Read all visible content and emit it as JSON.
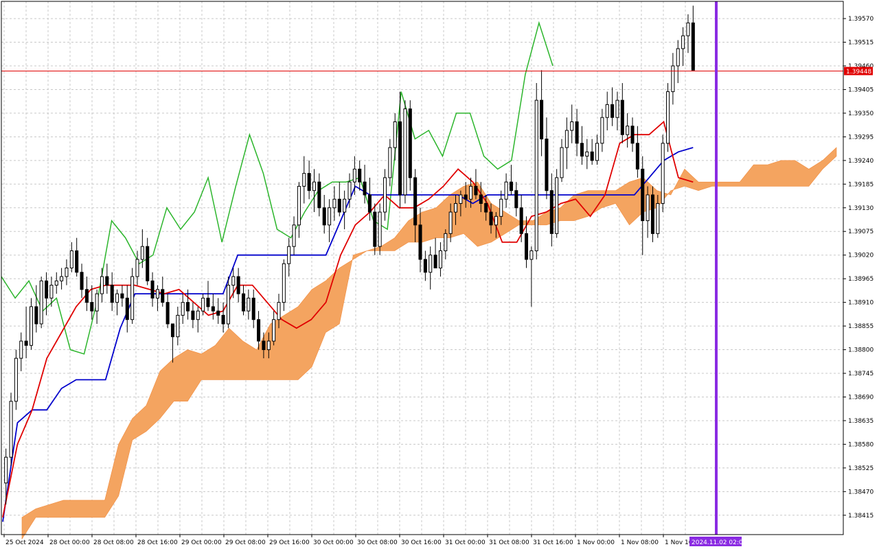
{
  "chart_data": {
    "type": "candlestick",
    "colors": {
      "background": "#ffffff",
      "grid": "#c8c8c8",
      "bull_candle": "#ffffff",
      "bear_candle": "#000000",
      "cloud": "#f4a460",
      "cloud_edge": "#f08a3c",
      "tenkan_sen": "#e00000",
      "kijun_sen": "#0000cc",
      "chikou_span": "#2bb52b",
      "price_line": "#e00000",
      "price_label_bg": "#e00000",
      "separator_line": "#8a2be2",
      "time_label_bg": "#8a2be2"
    },
    "y_ticks": [
      "1.39570",
      "1.39515",
      "1.39460",
      "1.39405",
      "1.39350",
      "1.39295",
      "1.39240",
      "1.39185",
      "1.39130",
      "1.39075",
      "1.39020",
      "1.38965",
      "1.38910",
      "1.38855",
      "1.38800",
      "1.38745",
      "1.38690",
      "1.38635",
      "1.38580",
      "1.38525",
      "1.38470",
      "1.38415"
    ],
    "x_ticks": [
      "25 Oct 2024",
      "28 Oct 00:00",
      "28 Oct 08:00",
      "28 Oct 16:00",
      "29 Oct 00:00",
      "29 Oct 08:00",
      "29 Oct 16:00",
      "30 Oct 00:00",
      "30 Oct 08:00",
      "30 Oct 16:00",
      "31 Oct 00:00",
      "31 Oct 08:00",
      "31 Oct 16:00",
      "1 Nov 00:00",
      "1 Nov 08:00",
      "1 Nov 16:"
    ],
    "ylim": [
      1.3837,
      1.3961
    ],
    "current_price": "1.39448",
    "separator_label": "2024.11.02 02:00",
    "candles": [
      [
        1.3849,
        1.3857,
        1.3844,
        1.3855
      ],
      [
        1.3855,
        1.387,
        1.3853,
        1.3868
      ],
      [
        1.3868,
        1.388,
        1.3866,
        1.3878
      ],
      [
        1.3878,
        1.3884,
        1.3875,
        1.3882
      ],
      [
        1.3882,
        1.389,
        1.3878,
        1.3881
      ],
      [
        1.3881,
        1.3892,
        1.388,
        1.389
      ],
      [
        1.389,
        1.3895,
        1.3884,
        1.3886
      ],
      [
        1.3886,
        1.3897,
        1.3885,
        1.3896
      ],
      [
        1.3896,
        1.3898,
        1.3888,
        1.3892
      ],
      [
        1.3892,
        1.3897,
        1.389,
        1.3895
      ],
      [
        1.3895,
        1.3898,
        1.3893,
        1.3896
      ],
      [
        1.3896,
        1.3899,
        1.3894,
        1.3897
      ],
      [
        1.3897,
        1.3901,
        1.3895,
        1.3899
      ],
      [
        1.3899,
        1.3905,
        1.3898,
        1.3903
      ],
      [
        1.3903,
        1.3906,
        1.3897,
        1.3898
      ],
      [
        1.3898,
        1.39,
        1.3892,
        1.3894
      ],
      [
        1.3894,
        1.3897,
        1.3889,
        1.3891
      ],
      [
        1.3891,
        1.3895,
        1.3887,
        1.3889
      ],
      [
        1.3889,
        1.3894,
        1.3886,
        1.3893
      ],
      [
        1.3893,
        1.3899,
        1.3891,
        1.3897
      ],
      [
        1.3897,
        1.39,
        1.3893,
        1.3895
      ],
      [
        1.3895,
        1.3898,
        1.3889,
        1.3891
      ],
      [
        1.3891,
        1.3894,
        1.3888,
        1.3893
      ],
      [
        1.3893,
        1.3895,
        1.389,
        1.3892
      ],
      [
        1.3892,
        1.3895,
        1.3884,
        1.3887
      ],
      [
        1.3887,
        1.3899,
        1.3886,
        1.3897
      ],
      [
        1.3897,
        1.3903,
        1.3895,
        1.3901
      ],
      [
        1.3901,
        1.3908,
        1.3899,
        1.3904
      ],
      [
        1.3904,
        1.3906,
        1.3895,
        1.3896
      ],
      [
        1.3896,
        1.3898,
        1.389,
        1.3892
      ],
      [
        1.3892,
        1.3895,
        1.3889,
        1.3894
      ],
      [
        1.3894,
        1.3897,
        1.389,
        1.3891
      ],
      [
        1.3891,
        1.3893,
        1.3885,
        1.3886
      ],
      [
        1.3886,
        1.3886,
        1.3877,
        1.3883
      ],
      [
        1.3883,
        1.389,
        1.3881,
        1.3888
      ],
      [
        1.3888,
        1.3893,
        1.3886,
        1.3891
      ],
      [
        1.3891,
        1.3894,
        1.3887,
        1.3889
      ],
      [
        1.3889,
        1.3891,
        1.3885,
        1.3887
      ],
      [
        1.3887,
        1.389,
        1.3884,
        1.3889
      ],
      [
        1.3889,
        1.3893,
        1.3888,
        1.3892
      ],
      [
        1.3892,
        1.3896,
        1.3889,
        1.389
      ],
      [
        1.389,
        1.3893,
        1.3887,
        1.3889
      ],
      [
        1.3889,
        1.3892,
        1.3886,
        1.3888
      ],
      [
        1.3888,
        1.3891,
        1.3884,
        1.3886
      ],
      [
        1.3886,
        1.3897,
        1.3885,
        1.3895
      ],
      [
        1.3895,
        1.3899,
        1.3892,
        1.3897
      ],
      [
        1.3897,
        1.3899,
        1.3891,
        1.3893
      ],
      [
        1.3893,
        1.3895,
        1.3888,
        1.3889
      ],
      [
        1.3889,
        1.3894,
        1.3887,
        1.3892
      ],
      [
        1.3892,
        1.3894,
        1.3885,
        1.3887
      ],
      [
        1.3887,
        1.3889,
        1.388,
        1.3882
      ],
      [
        1.3882,
        1.3884,
        1.3878,
        1.388
      ],
      [
        1.388,
        1.3884,
        1.3878,
        1.3882
      ],
      [
        1.3882,
        1.3889,
        1.3881,
        1.3887
      ],
      [
        1.3887,
        1.3893,
        1.3885,
        1.3891
      ],
      [
        1.3891,
        1.3901,
        1.3889,
        1.39
      ],
      [
        1.39,
        1.3906,
        1.3897,
        1.3904
      ],
      [
        1.3904,
        1.3911,
        1.3902,
        1.3909
      ],
      [
        1.3909,
        1.3919,
        1.3906,
        1.3918
      ],
      [
        1.3918,
        1.3925,
        1.3914,
        1.3921
      ],
      [
        1.3921,
        1.3924,
        1.3915,
        1.3917
      ],
      [
        1.3917,
        1.3922,
        1.3912,
        1.3919
      ],
      [
        1.3919,
        1.3921,
        1.3911,
        1.3913
      ],
      [
        1.3913,
        1.3916,
        1.3907,
        1.3909
      ],
      [
        1.3909,
        1.3915,
        1.3905,
        1.3913
      ],
      [
        1.3913,
        1.3918,
        1.391,
        1.3915
      ],
      [
        1.3915,
        1.3919,
        1.3911,
        1.3912
      ],
      [
        1.3912,
        1.3917,
        1.3908,
        1.3915
      ],
      [
        1.3915,
        1.3921,
        1.3913,
        1.3919
      ],
      [
        1.3919,
        1.3925,
        1.3916,
        1.3922
      ],
      [
        1.3922,
        1.3924,
        1.3917,
        1.3919
      ],
      [
        1.3919,
        1.3923,
        1.3914,
        1.3916
      ],
      [
        1.3916,
        1.392,
        1.391,
        1.3912
      ],
      [
        1.3912,
        1.3914,
        1.3902,
        1.3904
      ],
      [
        1.3904,
        1.3914,
        1.3902,
        1.3912
      ],
      [
        1.3912,
        1.3922,
        1.391,
        1.392
      ],
      [
        1.392,
        1.3929,
        1.3918,
        1.3927
      ],
      [
        1.3927,
        1.3935,
        1.3924,
        1.3933
      ],
      [
        1.3933,
        1.394,
        1.3913,
        1.3916
      ],
      [
        1.3916,
        1.3938,
        1.3914,
        1.3936
      ],
      [
        1.3936,
        1.3938,
        1.3917,
        1.392
      ],
      [
        1.392,
        1.3922,
        1.3905,
        1.3909
      ],
      [
        1.3909,
        1.3913,
        1.3898,
        1.3901
      ],
      [
        1.3901,
        1.3903,
        1.3896,
        1.3898
      ],
      [
        1.3898,
        1.3904,
        1.3894,
        1.3902
      ],
      [
        1.3902,
        1.3906,
        1.3899,
        1.3899
      ],
      [
        1.3899,
        1.3905,
        1.3897,
        1.3903
      ],
      [
        1.3903,
        1.3908,
        1.3901,
        1.3907
      ],
      [
        1.3907,
        1.3914,
        1.3905,
        1.3912
      ],
      [
        1.3912,
        1.3916,
        1.3909,
        1.3914
      ],
      [
        1.3914,
        1.3917,
        1.3911,
        1.3916
      ],
      [
        1.3916,
        1.3919,
        1.3913,
        1.3915
      ],
      [
        1.3915,
        1.392,
        1.3913,
        1.3918
      ],
      [
        1.3918,
        1.3922,
        1.3915,
        1.3916
      ],
      [
        1.3916,
        1.3919,
        1.3912,
        1.3914
      ],
      [
        1.3914,
        1.3916,
        1.391,
        1.3912
      ],
      [
        1.3912,
        1.3914,
        1.3907,
        1.3909
      ],
      [
        1.3909,
        1.3912,
        1.3906,
        1.3911
      ],
      [
        1.3911,
        1.3917,
        1.3909,
        1.3915
      ],
      [
        1.3915,
        1.3921,
        1.3913,
        1.3919
      ],
      [
        1.3919,
        1.3923,
        1.3916,
        1.3917
      ],
      [
        1.3917,
        1.3919,
        1.3911,
        1.3913
      ],
      [
        1.3913,
        1.3916,
        1.3905,
        1.3907
      ],
      [
        1.3907,
        1.3911,
        1.3899,
        1.3901
      ],
      [
        1.3901,
        1.3904,
        1.389,
        1.3903
      ],
      [
        1.3903,
        1.3942,
        1.3901,
        1.3938
      ],
      [
        1.3938,
        1.3945,
        1.3925,
        1.3929
      ],
      [
        1.3929,
        1.3934,
        1.3915,
        1.3917
      ],
      [
        1.3917,
        1.3921,
        1.3904,
        1.3907
      ],
      [
        1.3907,
        1.3922,
        1.3906,
        1.392
      ],
      [
        1.392,
        1.3929,
        1.3919,
        1.3927
      ],
      [
        1.3927,
        1.3934,
        1.3922,
        1.3931
      ],
      [
        1.3931,
        1.3937,
        1.3928,
        1.3933
      ],
      [
        1.3933,
        1.3936,
        1.3925,
        1.3928
      ],
      [
        1.3928,
        1.3932,
        1.3923,
        1.3925
      ],
      [
        1.3925,
        1.3929,
        1.3922,
        1.3926
      ],
      [
        1.3926,
        1.3929,
        1.3923,
        1.3924
      ],
      [
        1.3924,
        1.393,
        1.3923,
        1.3928
      ],
      [
        1.3928,
        1.3936,
        1.3926,
        1.3934
      ],
      [
        1.3934,
        1.394,
        1.3931,
        1.3937
      ],
      [
        1.3937,
        1.3941,
        1.3932,
        1.3934
      ],
      [
        1.3934,
        1.394,
        1.3931,
        1.3938
      ],
      [
        1.3938,
        1.3942,
        1.3928,
        1.393
      ],
      [
        1.393,
        1.3935,
        1.3927,
        1.3932
      ],
      [
        1.3932,
        1.3934,
        1.3926,
        1.3928
      ],
      [
        1.3928,
        1.3932,
        1.392,
        1.3922
      ],
      [
        1.3922,
        1.3925,
        1.3902,
        1.391
      ],
      [
        1.391,
        1.3918,
        1.3906,
        1.3916
      ],
      [
        1.3916,
        1.3918,
        1.3905,
        1.3907
      ],
      [
        1.3907,
        1.3916,
        1.3906,
        1.3914
      ],
      [
        1.3914,
        1.393,
        1.3912,
        1.3928
      ],
      [
        1.3928,
        1.3942,
        1.3926,
        1.394
      ],
      [
        1.394,
        1.3949,
        1.3937,
        1.3946
      ],
      [
        1.3946,
        1.3952,
        1.3942,
        1.395
      ],
      [
        1.395,
        1.3955,
        1.3946,
        1.3953
      ],
      [
        1.3953,
        1.3958,
        1.3949,
        1.3956
      ],
      [
        1.3956,
        1.396,
        1.3951,
        1.3945
      ]
    ],
    "tenkan_sen": [
      1.3841,
      1.3858,
      1.3866,
      1.3878,
      1.3884,
      1.389,
      1.3894,
      1.3895,
      1.3895,
      1.3895,
      1.3894,
      1.3893,
      1.3894,
      1.3891,
      1.3888,
      1.3889,
      1.3895,
      1.3895,
      1.3891,
      1.3887,
      1.3885,
      1.3887,
      1.3891,
      1.3902,
      1.3909,
      1.3912,
      1.3916,
      1.3913,
      1.3913,
      1.3915,
      1.3918,
      1.3922,
      1.3919,
      1.3914,
      1.3905,
      1.3905,
      1.3911,
      1.3912,
      1.3914,
      1.3915,
      1.3911,
      1.3916,
      1.3928,
      1.393,
      1.393,
      1.3933,
      1.392,
      1.3919
    ],
    "kijun_sen": [
      1.384,
      1.3863,
      1.3866,
      1.3866,
      1.3871,
      1.3873,
      1.3873,
      1.3873,
      1.3885,
      1.3893,
      1.3893,
      1.3893,
      1.3893,
      1.3893,
      1.3893,
      1.3893,
      1.3902,
      1.3902,
      1.3902,
      1.3902,
      1.3902,
      1.3902,
      1.3902,
      1.391,
      1.3918,
      1.3916,
      1.3916,
      1.3916,
      1.3916,
      1.3916,
      1.3916,
      1.3916,
      1.3914,
      1.3916,
      1.3916,
      1.3916,
      1.3916,
      1.3916,
      1.3916,
      1.3916,
      1.3916,
      1.3916,
      1.3916,
      1.3916,
      1.392,
      1.3924,
      1.3926,
      1.3927
    ],
    "chikou_span": [
      1.3897,
      1.3892,
      1.3896,
      1.3889,
      1.3892,
      1.388,
      1.3879,
      1.3892,
      1.391,
      1.3906,
      1.39,
      1.3902,
      1.3913,
      1.3908,
      1.3912,
      1.392,
      1.3905,
      1.3918,
      1.393,
      1.3921,
      1.3908,
      1.3906,
      1.3912,
      1.3917,
      1.3919,
      1.3919,
      1.392,
      1.391,
      1.3908,
      1.394,
      1.3929,
      1.3931,
      1.3925,
      1.3935,
      1.3935,
      1.3925,
      1.3922,
      1.3924,
      1.3944,
      1.3956,
      1.3946
    ],
    "senkou_span_a": [
      1.3841,
      1.3843,
      1.3844,
      1.3845,
      1.3845,
      1.3845,
      1.3845,
      1.3858,
      1.3864,
      1.3867,
      1.3875,
      1.3878,
      1.388,
      1.3879,
      1.3881,
      1.3885,
      1.3882,
      1.388,
      1.3886,
      1.3888,
      1.389,
      1.3894,
      1.3896,
      1.3899,
      1.3901,
      1.3903,
      1.3904,
      1.3906,
      1.391,
      1.3912,
      1.3913,
      1.3916,
      1.3918,
      1.3919,
      1.3914,
      1.3912,
      1.391,
      1.391,
      1.3912,
      1.3913,
      1.3916,
      1.3917,
      1.3917,
      1.3917,
      1.3919,
      1.392,
      1.3917,
      1.3916,
      1.3922,
      1.3919,
      1.3919,
      1.3919,
      1.3919,
      1.3923,
      1.3923,
      1.3924,
      1.3924,
      1.3922,
      1.3924,
      1.3927
    ],
    "senkou_span_b": [
      1.3836,
      1.3841,
      1.3841,
      1.3841,
      1.3841,
      1.3841,
      1.3841,
      1.3846,
      1.3859,
      1.3861,
      1.3864,
      1.3868,
      1.3868,
      1.3873,
      1.3873,
      1.3873,
      1.3873,
      1.3873,
      1.3873,
      1.3873,
      1.3873,
      1.3876,
      1.3884,
      1.3886,
      1.3902,
      1.3903,
      1.3903,
      1.3903,
      1.3905,
      1.3905,
      1.3906,
      1.3906,
      1.3907,
      1.3904,
      1.3905,
      1.3907,
      1.3909,
      1.3909,
      1.3909,
      1.391,
      1.391,
      1.3911,
      1.3913,
      1.3914,
      1.3909,
      1.3912,
      1.3913,
      1.3917,
      1.3918,
      1.3917,
      1.3918,
      1.3918,
      1.3918,
      1.3918,
      1.3918,
      1.3918,
      1.3918,
      1.3918,
      1.3922,
      1.3925
    ]
  }
}
